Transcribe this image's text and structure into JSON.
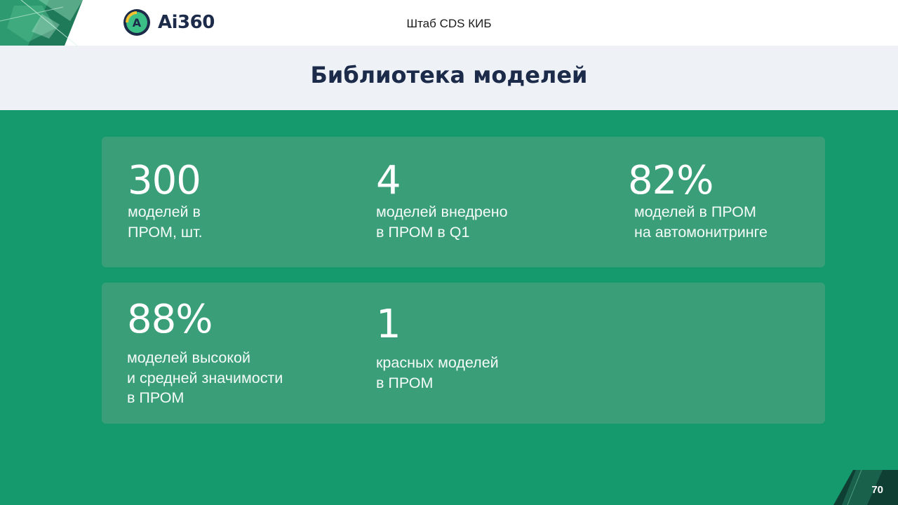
{
  "header": {
    "logo_text": "Ai360",
    "badge_letter": "A",
    "section_label": "Штаб CDS КИБ"
  },
  "title": "Библиотека моделей",
  "stats": [
    {
      "value": "300",
      "label": "моделей в\nПРОМ, шт."
    },
    {
      "value": "4",
      "label": "моделей внедрено\nв ПРОМ в Q1"
    },
    {
      "value": "82%",
      "label": "моделей в ПРОМ\nна автомонитринге"
    },
    {
      "value": "88%",
      "label": "моделей высокой\nи средней значимости\nв ПРОМ"
    },
    {
      "value": "1",
      "label": "красных моделей\nв ПРОМ"
    }
  ],
  "page_number": "70",
  "colors": {
    "background": "#159a6d",
    "card": "#3a9f78",
    "title_band": "#eef2f6",
    "title_text": "#1c2b4a"
  }
}
